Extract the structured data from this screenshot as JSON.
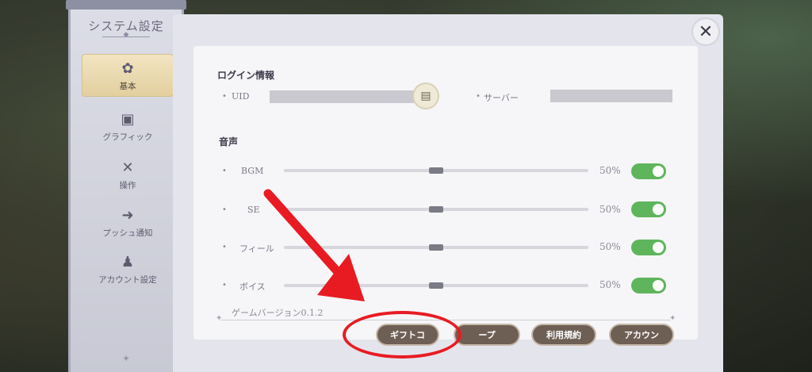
{
  "sidebar": {
    "title": "システム設定",
    "items": [
      {
        "label": "基本",
        "icon": "gear-icon"
      },
      {
        "label": "グラフィック",
        "icon": "image-icon"
      },
      {
        "label": "操作",
        "icon": "crossed-swords-icon"
      },
      {
        "label": "プッシュ通知",
        "icon": "arrow-circle-icon"
      },
      {
        "label": "アカウント設定",
        "icon": "user-icon"
      }
    ],
    "bottom_ornament": "ornament-icon"
  },
  "login": {
    "title": "ログイン情報",
    "uid_label": "UID",
    "server_label": "サーバー",
    "copy_icon": "copy-icon"
  },
  "audio": {
    "title": "音声",
    "channels": [
      {
        "label": "BGM",
        "value": "50%",
        "level": 0.5,
        "enabled": true
      },
      {
        "label": "SE",
        "value": "50%",
        "level": 0.5,
        "enabled": true
      },
      {
        "label": "フィール",
        "value": "50%",
        "level": 0.5,
        "enabled": true
      },
      {
        "label": "ボイス",
        "value": "50%",
        "level": 0.5,
        "enabled": true
      }
    ]
  },
  "version": "ゲームバージョン0.1.2",
  "buttons": {
    "gift": "ギフトコ",
    "tape": "ープ",
    "terms": "利用規約",
    "account": "アカウン"
  },
  "close_icon": "close-icon",
  "colors": {
    "toggle_on": "#5fb55c",
    "annotation_red": "#e81b23",
    "pill_button": "#6e5f55",
    "active_nav": "#e2cf9f"
  }
}
